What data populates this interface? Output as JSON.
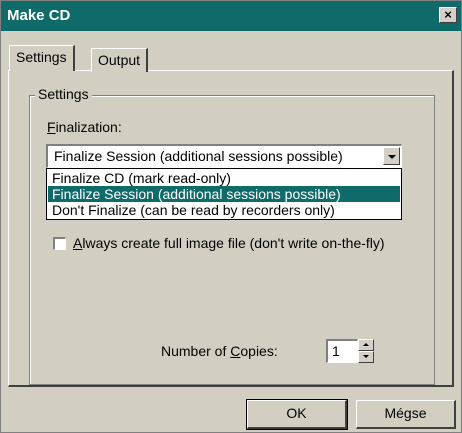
{
  "window": {
    "title": "Make CD",
    "close_glyph": "×"
  },
  "tabs": [
    {
      "label": "Settings",
      "active": true
    },
    {
      "label": "Output",
      "active": false
    }
  ],
  "settings_group": {
    "legend": "Settings",
    "finalization": {
      "label": "Finalization:",
      "label_underline_char": "F",
      "label_rest": "inalization:",
      "selected_value": "Finalize Session (additional sessions possible)",
      "options": [
        "Finalize CD (mark read-only)",
        "Finalize Session (additional sessions possible)",
        "Don't Finalize (can be read by recorders only)"
      ],
      "highlighted_index": 1
    },
    "full_image_checkbox": {
      "label_underline_char": "A",
      "label_rest": "lways create full image file (don't write on-the-fly)",
      "checked": false
    },
    "copies": {
      "label_before": "Number of ",
      "label_underline_char": "C",
      "label_after": "opies:",
      "value": "1"
    }
  },
  "buttons": {
    "ok": "OK",
    "cancel": "Mégse"
  },
  "colors": {
    "title_bar": "#0f6b69",
    "selection": "#0f6b69",
    "face": "#d2cfc2"
  },
  "icons": {
    "close": "close-icon",
    "dropdown": "chevron-down-icon",
    "spin_up": "spin-up-icon",
    "spin_down": "spin-down-icon"
  }
}
